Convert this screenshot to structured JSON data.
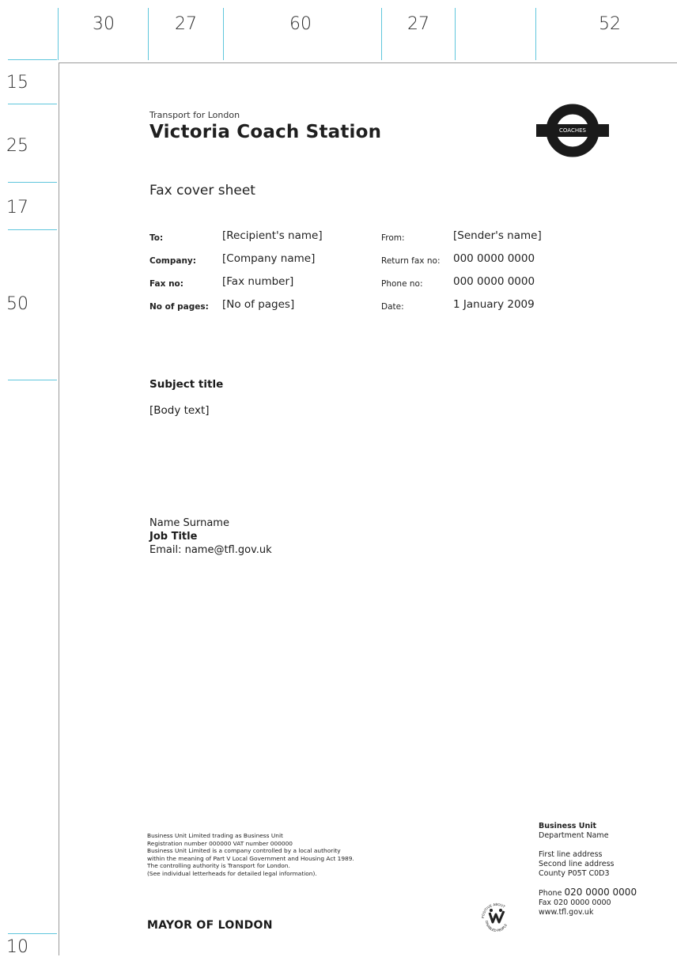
{
  "ruler": {
    "top": [
      "30",
      "27",
      "60",
      "27",
      "52"
    ],
    "left": [
      "15",
      "25",
      "17",
      "50",
      "10"
    ]
  },
  "header": {
    "org": "Transport for London",
    "title": "Victoria Coach Station",
    "logo_label": "COACHES"
  },
  "doc_type": "Fax cover sheet",
  "fields_left": [
    {
      "label": "To:",
      "value": "[Recipient's name]"
    },
    {
      "label": "Company:",
      "value": "[Company name]"
    },
    {
      "label": "Fax no:",
      "value": "[Fax number]"
    },
    {
      "label": "No of pages:",
      "value": "[No of pages]"
    }
  ],
  "fields_right": [
    {
      "label": "From:",
      "value": "[Sender's name]"
    },
    {
      "label": "Return fax no:",
      "value": "000 0000 0000"
    },
    {
      "label": "Phone no:",
      "value": "000 0000 0000"
    },
    {
      "label": "Date:",
      "value": "1 January 2009"
    }
  ],
  "subject_title": "Subject title",
  "body_text": "[Body text]",
  "signature": {
    "name": "Name Surname",
    "job_title": "Job Title",
    "email": "Email: name@tfl.gov.uk"
  },
  "legal_lines": [
    "Business Unit Limited trading as Business Unit",
    "Registration number 000000  VAT number 000000",
    "Business Unit Limited is a company controlled by a local authority",
    "within the meaning of Part V Local Government and Housing Act 1989.",
    "The controlling authority is Transport for London.",
    "(See individual letterheads for detailed legal information)."
  ],
  "mayor": "MAYOR OF LONDON",
  "badge_icon": "positive-about-disabled-people-icon",
  "badge_text": "POSITIVE ABOUT DISABLED PEOPLE",
  "address": {
    "unit": "Business Unit",
    "department": "Department Name",
    "line1": "First line address",
    "line2": "Second line address",
    "line3": "County P05T C0D3",
    "phone_label": "Phone",
    "phone": "020 0000 0000",
    "fax": "Fax 020 0000 0000",
    "web": "www.tfl.gov.uk"
  },
  "colors": {
    "guide": "#5fc6dc",
    "roundel": "#1a1a1a"
  }
}
